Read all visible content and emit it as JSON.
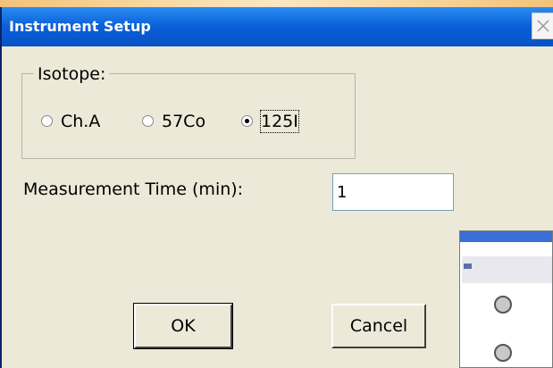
{
  "dialog": {
    "title": "Instrument Setup",
    "close_icon": "close-x-icon"
  },
  "isotope": {
    "legend": "Isotope:",
    "options": [
      {
        "label": "Ch.A",
        "selected": false
      },
      {
        "label": "57Co",
        "selected": false
      },
      {
        "label": "125I",
        "selected": true
      }
    ]
  },
  "measurement_time": {
    "label": "Measurement Time (min):",
    "value": "1"
  },
  "buttons": {
    "ok_label": "OK",
    "cancel_label": "Cancel"
  },
  "colors": {
    "titlebar": "#0a5fd8",
    "dialog_bg": "#ece9d8"
  }
}
